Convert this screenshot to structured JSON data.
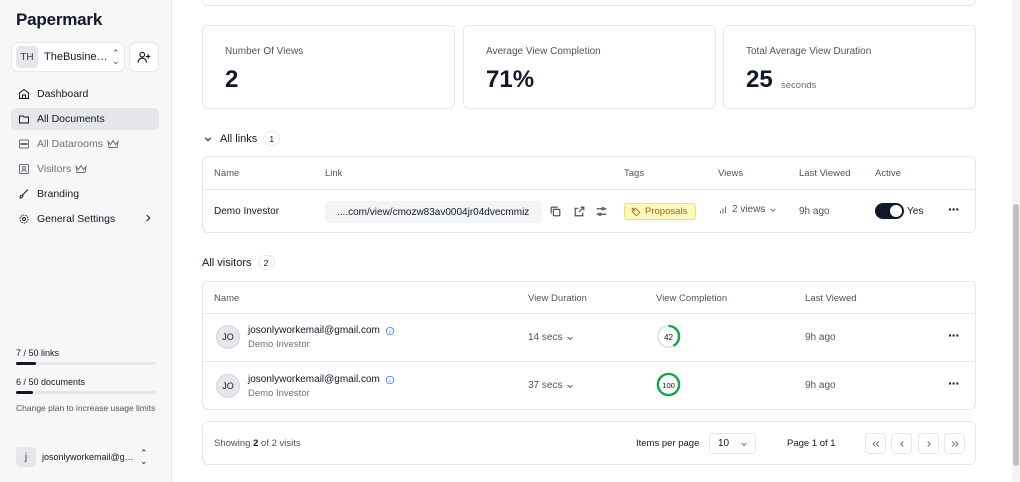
{
  "app": {
    "logo": "Papermark"
  },
  "team": {
    "initials": "TH",
    "name": "TheBusiness..."
  },
  "nav": [
    {
      "label": "Dashboard",
      "icon": "home-icon"
    },
    {
      "label": "All Documents",
      "icon": "folder-icon",
      "active": true
    },
    {
      "label": "All Datarooms",
      "icon": "server-icon",
      "crown": true
    },
    {
      "label": "Visitors",
      "icon": "contact-icon",
      "crown": true
    },
    {
      "label": "Branding",
      "icon": "brush-icon"
    },
    {
      "label": "General Settings",
      "icon": "gear-icon",
      "chevron": true
    }
  ],
  "usage": {
    "links_label": "7 / 50 links",
    "links_fraction": 0.14,
    "docs_label": "6 / 50 documents",
    "docs_fraction": 0.12,
    "plan_note": "Change plan to increase usage limits"
  },
  "user": {
    "initial": "j",
    "email": "josonlyworkemail@gm..."
  },
  "stats": [
    {
      "label": "Number Of Views",
      "value": "2",
      "unit": ""
    },
    {
      "label": "Average View Completion",
      "value": "71%",
      "unit": ""
    },
    {
      "label": "Total Average View Duration",
      "value": "25",
      "unit": "seconds"
    }
  ],
  "links_section": {
    "title": "All links",
    "count": "1",
    "headers": [
      "Name",
      "Link",
      "Tags",
      "Views",
      "Last Viewed",
      "Active"
    ],
    "rows": [
      {
        "name": "Demo Investor",
        "link": "....com/view/cmozw83av0004jr04dvecmmiz",
        "tag": "Proposals",
        "views": "2 views",
        "last_viewed": "9h ago",
        "active_label": "Yes",
        "active": true
      }
    ]
  },
  "visitors_section": {
    "title": "All visitors",
    "count": "2",
    "headers": [
      "Name",
      "View Duration",
      "View Completion",
      "Last Viewed"
    ],
    "rows": [
      {
        "initials": "JO",
        "email": "josonlyworkemail@gmail.com",
        "sub": "Demo Investor",
        "duration": "14 secs",
        "completion": 42,
        "completion_label": "42",
        "last_viewed": "9h ago"
      },
      {
        "initials": "JO",
        "email": "josonlyworkemail@gmail.com",
        "sub": "Demo Investor",
        "duration": "37 secs",
        "completion": 100,
        "completion_label": "100",
        "last_viewed": "9h ago"
      }
    ]
  },
  "pagination": {
    "showing_prefix": "Showing ",
    "showing_count": "2",
    "showing_suffix": " of 2 visits",
    "items_per_page_label": "Items per page",
    "items_per_page_value": "10",
    "page_label": "Page 1 of 1"
  },
  "colors": {
    "accent": "#111827",
    "progress": "#16a34a",
    "tag_bg": "#fef9c3",
    "tag_text": "#a16207"
  }
}
